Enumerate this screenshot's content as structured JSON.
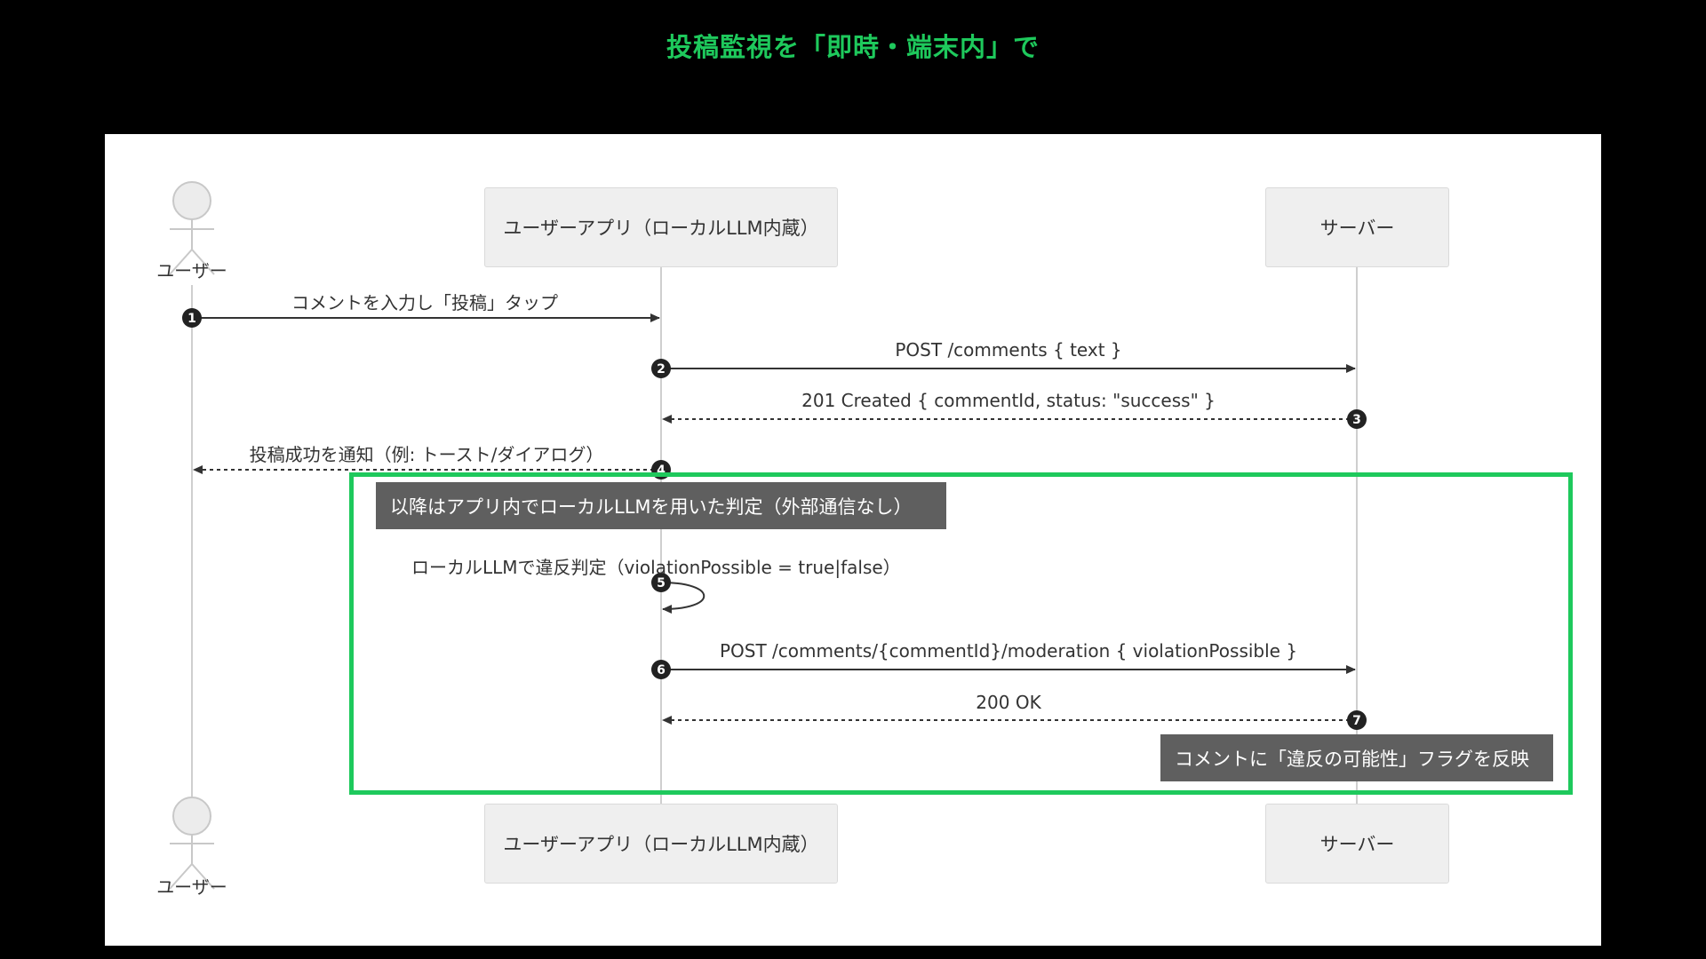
{
  "title": "投稿監視を「即時・端末内」で",
  "colors": {
    "accent": "#1ec95c",
    "note_bg": "#5f5f5f",
    "participant_bg": "#efefef",
    "line": "#333333"
  },
  "participants": {
    "user": "ユーザー",
    "app": "ユーザーアプリ（ローカルLLM内蔵）",
    "server": "サーバー"
  },
  "messages": [
    {
      "num": "1",
      "label": "コメントを入力し「投稿」タップ"
    },
    {
      "num": "2",
      "label": "POST /comments { text }"
    },
    {
      "num": "3",
      "label": "201 Created { commentId, status: \"success\" }"
    },
    {
      "num": "4",
      "label": "投稿成功を通知（例: トースト/ダイアログ）"
    },
    {
      "num": "5",
      "label": "ローカルLLMで違反判定（violationPossible = true|false）"
    },
    {
      "num": "6",
      "label": "POST /comments/{commentId}/moderation { violationPossible }"
    },
    {
      "num": "7",
      "label": "200 OK"
    }
  ],
  "notes": {
    "local_section": "以降はアプリ内でローカルLLMを用いた判定（外部通信なし）",
    "server_flag": "コメントに「違反の可能性」フラグを反映"
  }
}
